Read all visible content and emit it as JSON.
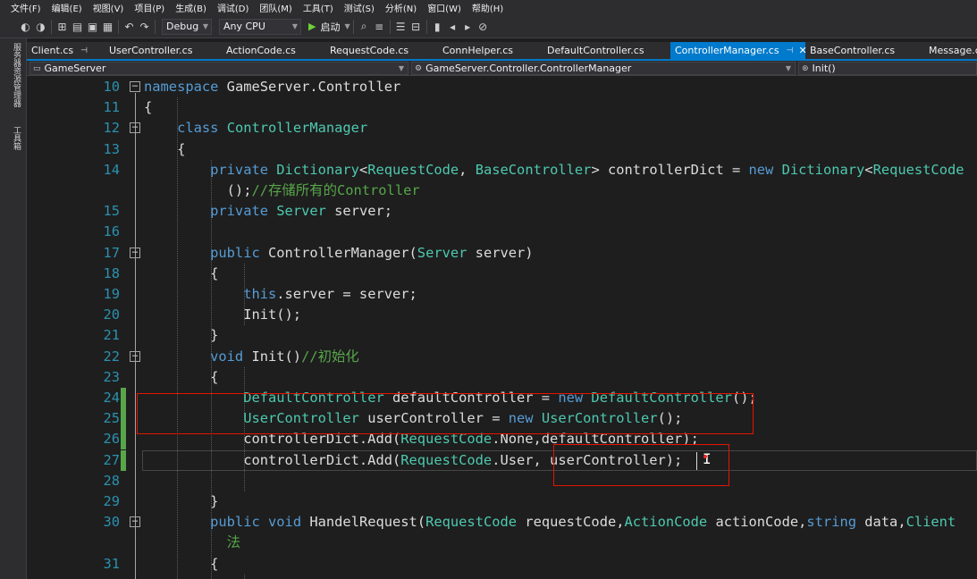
{
  "menu": [
    "文件(F)",
    "编辑(E)",
    "视图(V)",
    "项目(P)",
    "生成(B)",
    "调试(D)",
    "团队(M)",
    "工具(T)",
    "测试(S)",
    "分析(N)",
    "窗口(W)",
    "帮助(H)"
  ],
  "toolbar": {
    "configuration": "Debug",
    "platform": "Any CPU",
    "run_label": "启动",
    "icons": [
      "back-icon",
      "forward-icon",
      "new-project-icon",
      "open-folder-icon",
      "save-icon",
      "save-all-icon",
      "undo-icon",
      "redo-icon",
      "find-icon",
      "format-icon",
      "comment-icon",
      "uncomment-icon",
      "bookmark-icon",
      "prev-bookmark-icon",
      "next-bookmark-icon",
      "clear-bookmarks-icon"
    ]
  },
  "side_panel": {
    "tabs": [
      "服务器资源管理器",
      "工具箱"
    ]
  },
  "tabs": [
    {
      "label": "Client.cs",
      "pin": "⊣",
      "active": false
    },
    {
      "label": "UserController.cs",
      "active": false
    },
    {
      "label": "ActionCode.cs",
      "active": false
    },
    {
      "label": "RequestCode.cs",
      "active": false
    },
    {
      "label": "ConnHelper.cs",
      "active": false
    },
    {
      "label": "DefaultController.cs",
      "active": false
    },
    {
      "label": "ControllerManager.cs",
      "pin": "⊣",
      "close": "✕",
      "active": true
    },
    {
      "label": "BaseController.cs",
      "active": false
    },
    {
      "label": "Message.c",
      "active": false
    }
  ],
  "navbar": {
    "project": "GameServer",
    "class": "GameServer.Controller.ControllerManager",
    "member": "Init()"
  },
  "code": [
    {
      "line": "10",
      "spans": [
        {
          "t": "namespace",
          "c": "kw"
        },
        {
          "t": " GameServer.Controller",
          "c": "tx"
        }
      ]
    },
    {
      "line": "11",
      "spans": [
        {
          "t": "{",
          "c": "tx"
        }
      ]
    },
    {
      "line": "12",
      "spans": [
        {
          "t": "    class",
          "c": "kw"
        },
        {
          "t": " ",
          "c": "tx"
        },
        {
          "t": "ControllerManager",
          "c": "ty"
        }
      ]
    },
    {
      "line": "13",
      "spans": [
        {
          "t": "    {",
          "c": "tx"
        }
      ]
    },
    {
      "line": "14",
      "spans": [
        {
          "t": "        private",
          "c": "kw"
        },
        {
          "t": " ",
          "c": "tx"
        },
        {
          "t": "Dictionary",
          "c": "ty"
        },
        {
          "t": "<",
          "c": "tx"
        },
        {
          "t": "RequestCode",
          "c": "ty"
        },
        {
          "t": ", ",
          "c": "tx"
        },
        {
          "t": "BaseController",
          "c": "ty"
        },
        {
          "t": "> controllerDict = ",
          "c": "tx"
        },
        {
          "t": "new",
          "c": "kw"
        },
        {
          "t": " ",
          "c": "tx"
        },
        {
          "t": "Dictionary",
          "c": "ty"
        },
        {
          "t": "<",
          "c": "tx"
        },
        {
          "t": "RequestCode",
          "c": "ty"
        }
      ]
    },
    {
      "line": "",
      "spans": [
        {
          "t": "          ();",
          "c": "tx"
        },
        {
          "t": "//存储所有的Controller",
          "c": "cm"
        }
      ]
    },
    {
      "line": "15",
      "spans": [
        {
          "t": "        private",
          "c": "kw"
        },
        {
          "t": " ",
          "c": "tx"
        },
        {
          "t": "Server",
          "c": "ty"
        },
        {
          "t": " server;",
          "c": "tx"
        }
      ]
    },
    {
      "line": "16",
      "spans": []
    },
    {
      "line": "17",
      "spans": [
        {
          "t": "        public",
          "c": "kw"
        },
        {
          "t": " ControllerManager(",
          "c": "tx"
        },
        {
          "t": "Server",
          "c": "ty"
        },
        {
          "t": " server)",
          "c": "tx"
        }
      ]
    },
    {
      "line": "18",
      "spans": [
        {
          "t": "        {",
          "c": "tx"
        }
      ]
    },
    {
      "line": "19",
      "spans": [
        {
          "t": "            this",
          "c": "kw"
        },
        {
          "t": ".server = server;",
          "c": "tx"
        }
      ]
    },
    {
      "line": "20",
      "spans": [
        {
          "t": "            Init();",
          "c": "tx"
        }
      ]
    },
    {
      "line": "21",
      "spans": [
        {
          "t": "        }",
          "c": "tx"
        }
      ]
    },
    {
      "line": "22",
      "spans": [
        {
          "t": "        void",
          "c": "kw"
        },
        {
          "t": " Init()",
          "c": "tx"
        },
        {
          "t": "//初始化",
          "c": "cm"
        }
      ]
    },
    {
      "line": "23",
      "spans": [
        {
          "t": "        {",
          "c": "tx"
        }
      ]
    },
    {
      "line": "24",
      "spans": [
        {
          "t": "            ",
          "c": "tx"
        },
        {
          "t": "DefaultController",
          "c": "ty"
        },
        {
          "t": " defaultController = ",
          "c": "tx"
        },
        {
          "t": "new",
          "c": "kw"
        },
        {
          "t": " ",
          "c": "tx"
        },
        {
          "t": "DefaultController",
          "c": "ty"
        },
        {
          "t": "();",
          "c": "tx"
        }
      ]
    },
    {
      "line": "25",
      "spans": [
        {
          "t": "            ",
          "c": "tx"
        },
        {
          "t": "UserController",
          "c": "ty"
        },
        {
          "t": " userController = ",
          "c": "tx"
        },
        {
          "t": "new",
          "c": "kw"
        },
        {
          "t": " ",
          "c": "tx"
        },
        {
          "t": "UserController",
          "c": "ty"
        },
        {
          "t": "();",
          "c": "tx"
        }
      ]
    },
    {
      "line": "26",
      "spans": [
        {
          "t": "            controllerDict.Add(",
          "c": "tx"
        },
        {
          "t": "RequestCode",
          "c": "ty"
        },
        {
          "t": ".None,defaultController);",
          "c": "tx"
        }
      ]
    },
    {
      "line": "27",
      "spans": [
        {
          "t": "            controllerDict.Add(",
          "c": "tx"
        },
        {
          "t": "RequestCode",
          "c": "ty"
        },
        {
          "t": ".User, userController);",
          "c": "tx"
        }
      ]
    },
    {
      "line": "28",
      "spans": []
    },
    {
      "line": "29",
      "spans": [
        {
          "t": "        }",
          "c": "tx"
        }
      ]
    },
    {
      "line": "30",
      "spans": [
        {
          "t": "        public",
          "c": "kw"
        },
        {
          "t": " ",
          "c": "tx"
        },
        {
          "t": "void",
          "c": "kw"
        },
        {
          "t": " HandelRequest(",
          "c": "tx"
        },
        {
          "t": "RequestCode",
          "c": "ty"
        },
        {
          "t": " requestCode,",
          "c": "tx"
        },
        {
          "t": "ActionCode",
          "c": "ty"
        },
        {
          "t": " actionCode,",
          "c": "tx"
        },
        {
          "t": "string",
          "c": "kw"
        },
        {
          "t": " data,",
          "c": "tx"
        },
        {
          "t": "Client",
          "c": "ty"
        }
      ]
    },
    {
      "line": "",
      "spans": [
        {
          "t": "          法",
          "c": "cm"
        }
      ]
    },
    {
      "line": "31",
      "spans": [
        {
          "t": "        {",
          "c": "tx"
        }
      ]
    }
  ],
  "colors": {
    "keyword": "#569cd6",
    "type": "#4ec9b0",
    "comment": "#57a64a",
    "text": "#dcdcdc",
    "line_number": "#2b91af",
    "accent": "#007acc",
    "annotation": "#e51400"
  }
}
